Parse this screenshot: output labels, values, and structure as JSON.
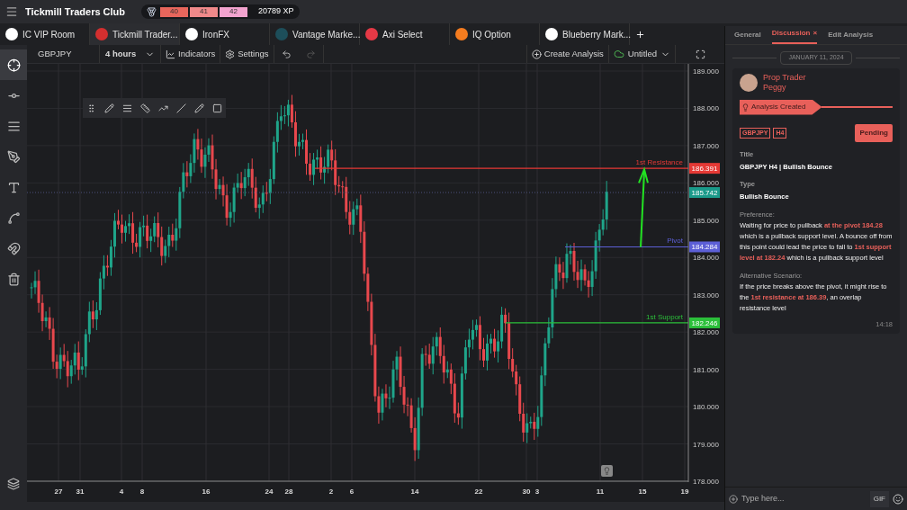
{
  "app": {
    "title": "Tickmill Traders Club"
  },
  "xp": {
    "levels": [
      {
        "label": "40",
        "color": "#e8665c"
      },
      {
        "label": "41",
        "color": "#f0898a"
      },
      {
        "label": "42",
        "color": "#f2a3cf"
      }
    ],
    "points": "20789 XP"
  },
  "broker_tabs": [
    {
      "label": "IC VIP Room",
      "color": "#ffffff",
      "selected": false
    },
    {
      "label": "Tickmill Trader...",
      "color": "#d32f2f",
      "selected": true
    },
    {
      "label": "IronFX",
      "color": "#ffffff",
      "selected": false
    },
    {
      "label": "Vantage Marke...",
      "color": "#1d4e5a",
      "selected": false
    },
    {
      "label": "Axi Select",
      "color": "#e53946",
      "selected": false
    },
    {
      "label": "IQ Option",
      "color": "#f57c1f",
      "selected": false
    },
    {
      "label": "Blueberry Mark...",
      "color": "#ffffff",
      "selected": false
    }
  ],
  "toolbar": {
    "symbol": "GBPJPY",
    "interval": "4 hours",
    "indicators": "Indicators",
    "settings": "Settings",
    "undo_disabled": false,
    "redo_disabled": true,
    "create": "Create Analysis",
    "layout": "Untitled"
  },
  "tools": [
    {
      "kind": "crosshair",
      "selected": true
    },
    {
      "kind": "line",
      "selected": false
    },
    {
      "kind": "lines",
      "selected": false
    },
    {
      "kind": "pen",
      "selected": false
    },
    {
      "kind": "text",
      "selected": false
    },
    {
      "kind": "pattern",
      "selected": false
    },
    {
      "kind": "magnet",
      "selected": false
    },
    {
      "kind": "trash",
      "selected": false
    }
  ],
  "chart": {
    "price_ticks": [
      "189.000",
      "188.000",
      "187.000",
      "186.000",
      "185.000",
      "184.000",
      "183.000",
      "182.000",
      "181.000",
      "180.000",
      "179.000",
      "178.000"
    ],
    "date_ticks": [
      "27",
      "31",
      "4",
      "8",
      "16",
      "24",
      "28",
      "2",
      "6",
      "14",
      "22",
      "30",
      "3",
      "11",
      "15",
      "19"
    ],
    "levels": [
      {
        "label": "1st Resistance",
        "price": "186.391",
        "color": "#e53935"
      },
      {
        "label": "Pivot",
        "price": "184.284",
        "color": "#5c5fd6"
      },
      {
        "label": "1st Support",
        "price": "182.246",
        "color": "#2bbf3a"
      }
    ],
    "last_price": "185.742"
  },
  "panel": {
    "tabs": [
      {
        "label": "General",
        "selected": false
      },
      {
        "label": "Discussion",
        "selected": true
      },
      {
        "label": "Edit Analysis",
        "selected": false
      }
    ],
    "close": "×",
    "date": "JANUARY 11, 2024",
    "author": {
      "role": "Prop Trader",
      "name": "Peggy"
    },
    "event": "Analysis Created",
    "tags": [
      "GBPJPY",
      "H4"
    ],
    "status": "Pending",
    "fields": [
      {
        "kind": "heading",
        "label": "Title",
        "value": "GBPJPY H4 | Bullish Bounce"
      },
      {
        "kind": "heading",
        "label": "Type",
        "value": "Bullish Bounce"
      },
      {
        "kind": "note",
        "label": "Preference:",
        "value": "Waiting for price to pullback **at the pivot 184.28** which is a pullback support level. A bounce off from this point could lead the price to fall to **1st support level at 182.24** which is a pullback support level"
      },
      {
        "kind": "note",
        "label": "Alternative Scenario:",
        "value": "If the price breaks above the pivot, it might rise to the **1st resistance at 186.39**, an overlap resistance level"
      }
    ],
    "time": "14:18",
    "composer": {
      "placeholder": "Type here...",
      "gif": "GIF"
    }
  }
}
